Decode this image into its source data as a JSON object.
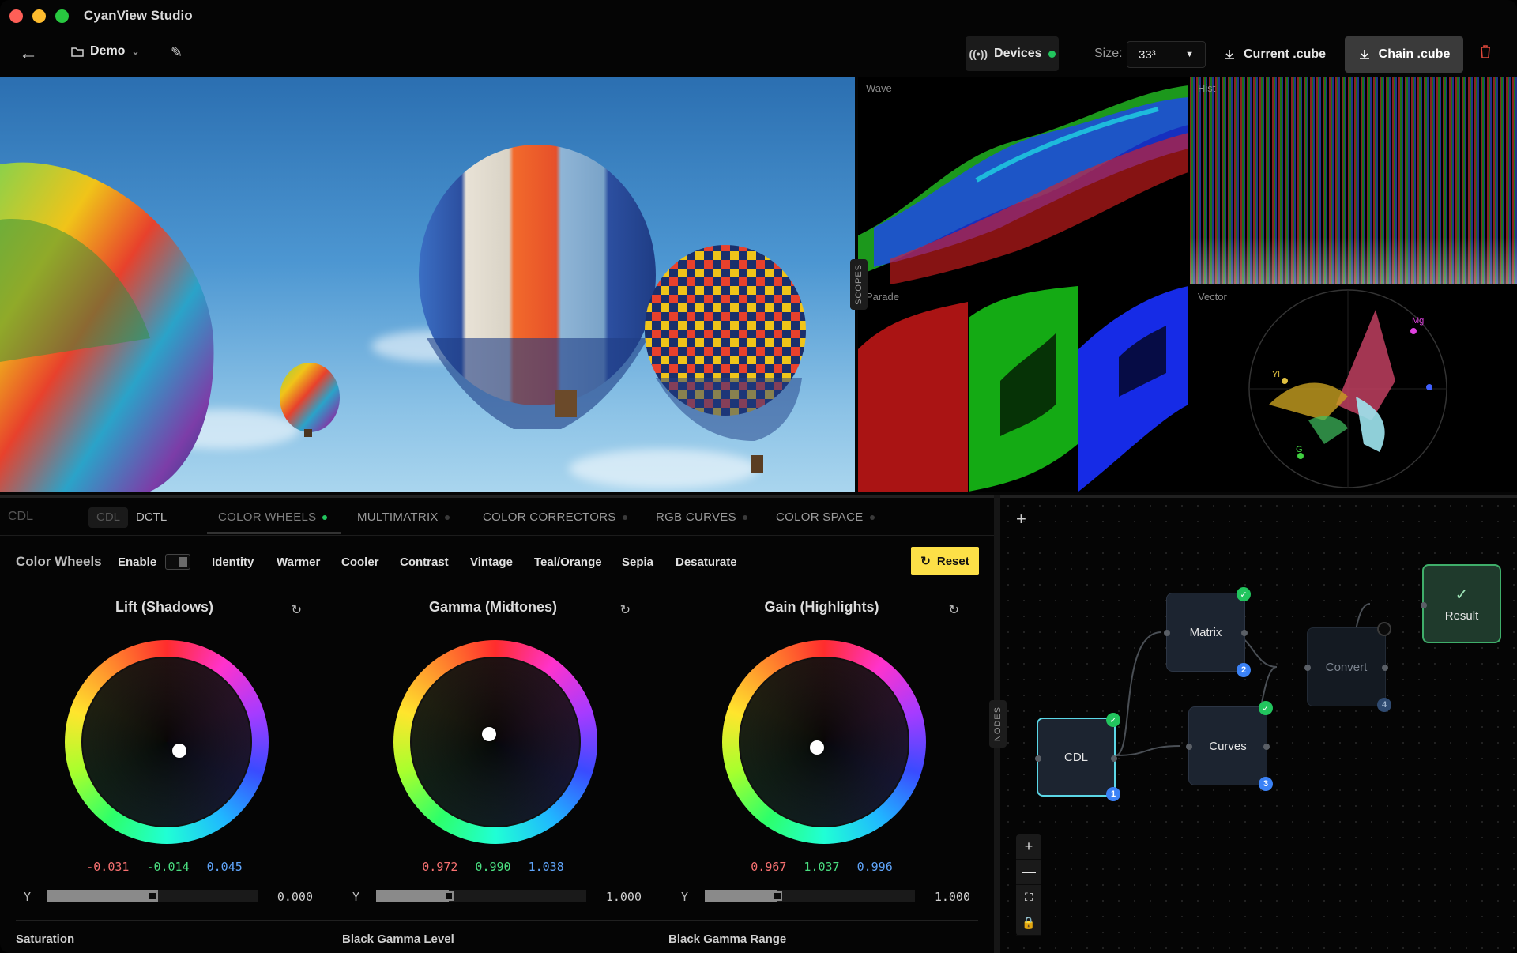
{
  "app": {
    "title": "CyanView Studio"
  },
  "toolbar": {
    "project": "Demo",
    "devices_label": "Devices",
    "size_label": "Size:",
    "size_value": "33³",
    "current_cube_label": "Current .cube",
    "chain_cube_label": "Chain .cube"
  },
  "scopes": {
    "side_label": "SCOPES",
    "wave_label": "Wave",
    "hist_label": "Hist",
    "parade_label": "Parade",
    "vector_label": "Vector",
    "vector_targets": {
      "mg": "Mg",
      "yl": "Yl",
      "g": "G"
    }
  },
  "panel": {
    "left_label": "CDL",
    "segments": [
      "CDL",
      "DCTL"
    ],
    "tabs": [
      {
        "label": "COLOR WHEELS",
        "active": true
      },
      {
        "label": "MULTIMATRIX",
        "active": false
      },
      {
        "label": "COLOR CORRECTORS",
        "active": false
      },
      {
        "label": "RGB CURVES",
        "active": false
      },
      {
        "label": "COLOR SPACE",
        "active": false
      }
    ]
  },
  "color_wheels": {
    "title": "Color Wheels",
    "enable_label": "Enable",
    "enabled": false,
    "presets": [
      "Identity",
      "Warmer",
      "Cooler",
      "Contrast",
      "Vintage",
      "Teal/Orange",
      "Sepia",
      "Desaturate"
    ],
    "reset_label": "Reset",
    "y_label": "Y",
    "wheels": [
      {
        "title": "Lift (Shadows)",
        "r": "-0.031",
        "g": "-0.014",
        "b": "0.045",
        "y": "0.000",
        "y_fraction": 0.5
      },
      {
        "title": "Gamma (Midtones)",
        "r": "0.972",
        "g": "0.990",
        "b": "1.038",
        "y": "1.000",
        "y_fraction": 0.35
      },
      {
        "title": "Gain (Highlights)",
        "r": "0.967",
        "g": "1.037",
        "b": "0.996",
        "y": "1.000",
        "y_fraction": 0.35
      }
    ],
    "bottom_labels": [
      "Saturation",
      "Black Gamma Level",
      "Black Gamma Range"
    ]
  },
  "nodes": {
    "side_label": "NODES",
    "items": [
      {
        "label": "CDL",
        "num": "1",
        "state": "ok",
        "selected": true
      },
      {
        "label": "Matrix",
        "num": "2",
        "state": "ok"
      },
      {
        "label": "Curves",
        "num": "3",
        "state": "ok"
      },
      {
        "label": "Convert",
        "num": "4",
        "state": "pending"
      },
      {
        "label": "Result"
      }
    ]
  },
  "colors": {
    "accent": "#5bd7e6",
    "ok": "#22c55e",
    "reset": "#fde047",
    "delete": "#e0483b"
  }
}
